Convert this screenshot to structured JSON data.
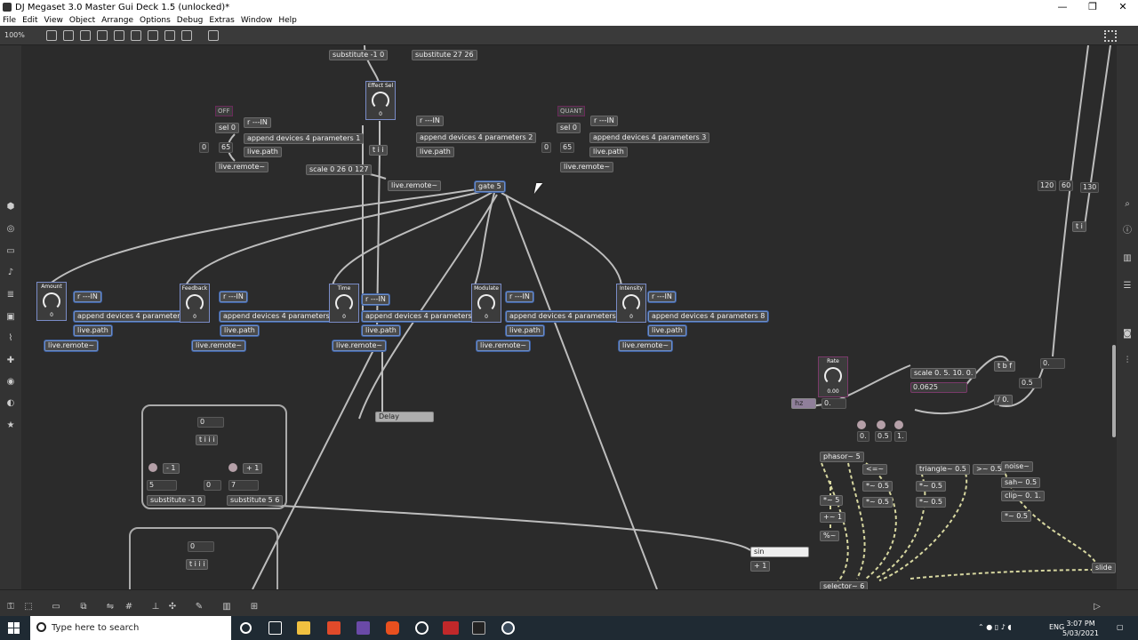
{
  "window": {
    "title": "DJ Megaset 3.0 Master Gui Deck 1.5 (unlocked)*",
    "controls": [
      "—",
      "❐",
      "✕"
    ]
  },
  "menu": [
    "File",
    "Edit",
    "View",
    "Object",
    "Arrange",
    "Options",
    "Debug",
    "Extras",
    "Window",
    "Help"
  ],
  "toolbar": {
    "zoom": "100%"
  },
  "patch": {
    "objects": {
      "substitute_a": "substitute -1 0",
      "substitute_b": "substitute 27 26",
      "effect_sel": "Effect Sel",
      "off_msg": "OFF",
      "quant_msg": "QUANT",
      "sel0_a": "sel 0",
      "sel0_b": "sel 0",
      "rin_a": "r ---IN",
      "rin_b": "r ---IN",
      "rin_c": "r ---IN",
      "append1": "append devices 4 parameters 1",
      "append2": "append devices 4 parameters 2",
      "append3": "append devices 4 parameters 3",
      "livepath_a": "live.path",
      "livepath_b": "live.path",
      "livepath_c": "live.path",
      "num0_a": "0",
      "num65_a": "65",
      "num0_b": "0",
      "num65_b": "65",
      "liveremote_a": "live.remote~",
      "liveremote_b": "live.remote~",
      "liveremote_c": "live.remote~",
      "scale_a": "scale 0 26 0 127",
      "tii": "t i i",
      "gate5": "gate 5",
      "num120": "120",
      "num60": "60",
      "num130": "130",
      "ti_b": "t i"
    },
    "dials": [
      {
        "label": "Amount",
        "value": "0"
      },
      {
        "label": "Feedback",
        "value": "0"
      },
      {
        "label": "Time",
        "value": "0"
      },
      {
        "label": "Modulate",
        "value": "0"
      },
      {
        "label": "Intensity",
        "value": "0"
      }
    ],
    "effectsel_value": "0",
    "row": {
      "rin": "r ---IN",
      "append5": "append devices 4 parameters 5",
      "append6": "append devices 4 parameters 6",
      "append4": "append devices 4 parameters 4",
      "append7": "append devices 4 parameters 7",
      "append8": "append devices 4 parameters 8",
      "livepath": "live.path",
      "liveremote": "live.remote~"
    },
    "delay": "Delay",
    "panel1": {
      "num0": "0",
      "tiii": "t i i i",
      "m1": "- 1",
      "p1": "+ 1",
      "n5": "5",
      "n0": "0",
      "n7": "7",
      "sub1": "substitute -1 0",
      "sub2": "substitute 5 6"
    },
    "panel2": {
      "num0": "0",
      "tiii": "t i i i"
    },
    "sin_msg": "sin",
    "plus1": "+ 1",
    "rate": {
      "label": "Rate",
      "value": "0.00"
    },
    "hz": "hz",
    "rate_num": "0.",
    "scale_b": "scale 0. 5. 10. 0.",
    "scale_num": "0.0625",
    "tbf": "t b f",
    "div": "/ 0.",
    "num0dot": "0.",
    "n05": "0.5",
    "small_nums": [
      "0.",
      "0.5",
      "1."
    ],
    "phasor": "phasor~ 5",
    "ops": [
      "*~ 5",
      "+~ 1",
      "%~",
      "<=~",
      "*~ 0.5",
      "*~ 0.5",
      "triangle~ 0.5",
      "*~ 0.5",
      ">~ 0.5",
      "noise~",
      "sah~ 0.5",
      "clip~ 0. 1.",
      "*~ 0.5",
      "*~ 0.5",
      "slide",
      "selector~ 6"
    ]
  },
  "taskbar": {
    "search_placeholder": "Type here to search",
    "lang": "ENG",
    "time": "3:07 PM",
    "date": "5/03/2021"
  },
  "colors": {
    "canvas": "#2b2b2b",
    "object": "#4a4a4a",
    "selection": "#6f8fc7",
    "patchcord": "#bfbfbf",
    "signal_cord": "#d7d7a0"
  }
}
